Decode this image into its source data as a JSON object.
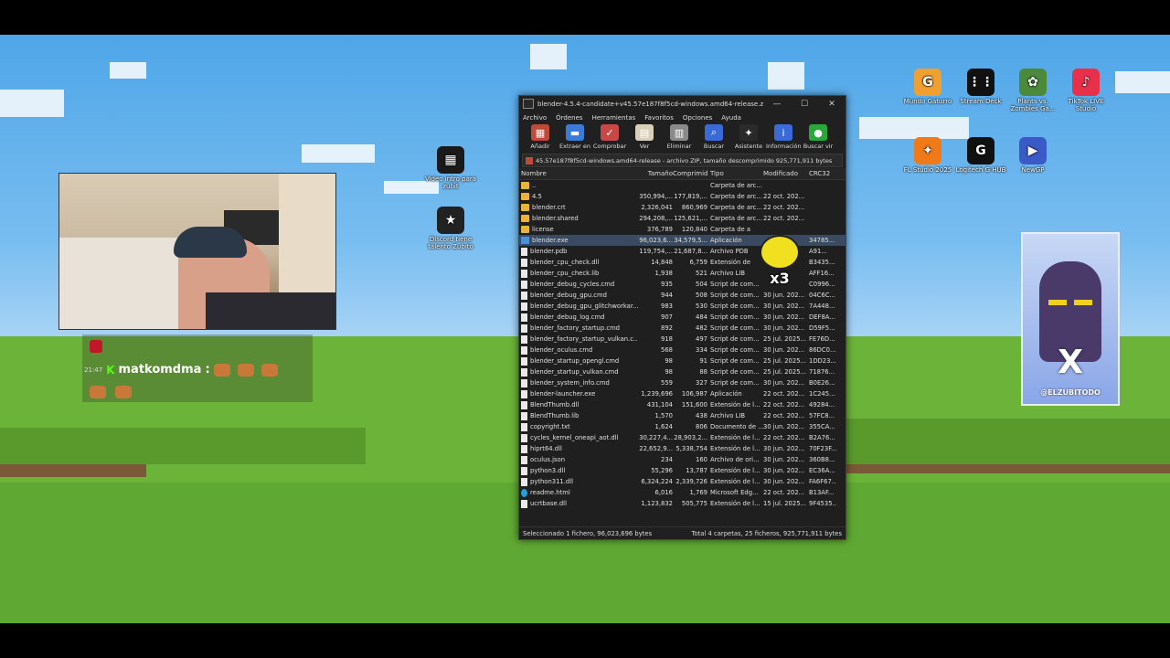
{
  "desktop": {
    "icons": [
      {
        "label": "Video intro para zubit",
        "symbol": "▦",
        "color": "#1a1a1a"
      },
      {
        "label": "Discord tiene talento Zubito",
        "symbol": "★",
        "color": "#222"
      },
      {
        "label": "Mundo Gaturro",
        "symbol": "G",
        "color": "#f0a030"
      },
      {
        "label": "Stream Deck",
        "symbol": "⋮⋮",
        "color": "#111"
      },
      {
        "label": "Plants vs. Zombies Ga...",
        "symbol": "✿",
        "color": "#4a8a3a"
      },
      {
        "label": "TikTok LIVE Studio",
        "symbol": "♪",
        "color": "#e8304a"
      },
      {
        "label": "FL Studio 2025",
        "symbol": "✦",
        "color": "#f07a18"
      },
      {
        "label": "Logitech G HUB",
        "symbol": "G",
        "color": "#111"
      },
      {
        "label": "NewGP",
        "symbol": "▶",
        "color": "#3a5ac8"
      }
    ]
  },
  "chat": {
    "time": "21:47",
    "user": "matkomdma",
    "separator": ":"
  },
  "window": {
    "title": "blender-4.5.4-candidate+v45.57e187f8f5cd-windows.amd64-release.zip (c...",
    "controls": {
      "minimize": "—",
      "maximize": "☐",
      "close": "✕"
    },
    "menu": [
      "Archivo",
      "Órdenes",
      "Herramientas",
      "Favoritos",
      "Opciones",
      "Ayuda"
    ],
    "toolbar": [
      {
        "label": "Añadir",
        "icon": "add-icon",
        "color": "#c04a3a",
        "glyph": "▦"
      },
      {
        "label": "Extraer en",
        "icon": "extract-icon",
        "color": "#3a7ad8",
        "glyph": "▬"
      },
      {
        "label": "Comprobar",
        "icon": "check-icon",
        "color": "#c84848",
        "glyph": "✓"
      },
      {
        "label": "Ver",
        "icon": "view-icon",
        "color": "#d8d0b8",
        "glyph": "▤"
      },
      {
        "label": "Eliminar",
        "icon": "delete-icon",
        "color": "#8a8a8a",
        "glyph": "▥"
      },
      {
        "label": "Buscar",
        "icon": "search-icon",
        "color": "#3a6ad8",
        "glyph": "⌕"
      },
      {
        "label": "Asistente",
        "icon": "wizard-icon",
        "color": "#2a2a2a",
        "glyph": "✦"
      },
      {
        "label": "Información",
        "icon": "info-icon",
        "color": "#3a6ad8",
        "glyph": "i"
      },
      {
        "label": "Buscar vir",
        "icon": "virus-scan-icon",
        "color": "#2aa83a",
        "glyph": "●"
      }
    ],
    "path": "45.57e187f8f5cd-windows.amd64-release - archivo ZIP, tamaño descomprimido 925,771,911 bytes",
    "columns": {
      "name": "Nombre",
      "size": "Tamaño",
      "compressed": "Comprimid",
      "type": "Tipo",
      "modified": "Modificado",
      "crc": "CRC32"
    },
    "rows": [
      {
        "name": "..",
        "kind": "folder",
        "size": "",
        "comp": "",
        "type": "Carpeta de arc...",
        "mod": "",
        "crc": ""
      },
      {
        "name": "4.5",
        "kind": "folder",
        "size": "350,994,...",
        "comp": "177,819,...",
        "type": "Carpeta de arc...",
        "mod": "22 oct. 202...",
        "crc": ""
      },
      {
        "name": "blender.crt",
        "kind": "folder",
        "size": "2,326,041",
        "comp": "860,969",
        "type": "Carpeta de arc...",
        "mod": "22 oct. 202...",
        "crc": ""
      },
      {
        "name": "blender.shared",
        "kind": "folder",
        "size": "294,208,...",
        "comp": "125,621,...",
        "type": "Carpeta de arc...",
        "mod": "22 oct. 202...",
        "crc": ""
      },
      {
        "name": "license",
        "kind": "folder",
        "size": "376,789",
        "comp": "120,840",
        "type": "Carpeta de a",
        "mod": "",
        "crc": ""
      },
      {
        "name": "blender.exe",
        "kind": "exe",
        "size": "96,023,6...",
        "comp": "34,579,5...",
        "type": "Aplicación",
        "mod": "",
        "crc": "34785...",
        "selected": true
      },
      {
        "name": "blender.pdb",
        "kind": "file",
        "size": "119,754,...",
        "comp": "21,687,8...",
        "type": "Archivo PDB",
        "mod": "",
        "crc": "A91..."
      },
      {
        "name": "blender_cpu_check.dll",
        "kind": "file",
        "size": "14,848",
        "comp": "6,759",
        "type": "Extensión de",
        "mod": "",
        "crc": "B3435..."
      },
      {
        "name": "blender_cpu_check.lib",
        "kind": "file",
        "size": "1,938",
        "comp": "521",
        "type": "Archivo LIB",
        "mod": "",
        "crc": "AFF16..."
      },
      {
        "name": "blender_debug_cycles.cmd",
        "kind": "file",
        "size": "935",
        "comp": "504",
        "type": "Script de com...",
        "mod": "",
        "crc": "C0996..."
      },
      {
        "name": "blender_debug_gpu.cmd",
        "kind": "file",
        "size": "944",
        "comp": "508",
        "type": "Script de com...",
        "mod": "30 jun. 202...",
        "crc": "04C6C..."
      },
      {
        "name": "blender_debug_gpu_glitchworkar...",
        "kind": "file",
        "size": "983",
        "comp": "530",
        "type": "Script de com...",
        "mod": "30 jun. 202...",
        "crc": "7A448..."
      },
      {
        "name": "blender_debug_log.cmd",
        "kind": "file",
        "size": "907",
        "comp": "484",
        "type": "Script de com...",
        "mod": "30 jun. 202...",
        "crc": "DEF8A..."
      },
      {
        "name": "blender_factory_startup.cmd",
        "kind": "file",
        "size": "892",
        "comp": "482",
        "type": "Script de com...",
        "mod": "30 jun. 202...",
        "crc": "D59F5..."
      },
      {
        "name": "blender_factory_startup_vulkan.c...",
        "kind": "file",
        "size": "918",
        "comp": "497",
        "type": "Script de com...",
        "mod": "25 jul. 2025...",
        "crc": "FE76D..."
      },
      {
        "name": "blender_oculus.cmd",
        "kind": "file",
        "size": "568",
        "comp": "334",
        "type": "Script de com...",
        "mod": "30 jun. 202...",
        "crc": "86DC0..."
      },
      {
        "name": "blender_startup_opengl.cmd",
        "kind": "file",
        "size": "98",
        "comp": "91",
        "type": "Script de com...",
        "mod": "25 jul. 2025...",
        "crc": "1DD23..."
      },
      {
        "name": "blender_startup_vulkan.cmd",
        "kind": "file",
        "size": "98",
        "comp": "88",
        "type": "Script de com...",
        "mod": "25 jul. 2025...",
        "crc": "71876..."
      },
      {
        "name": "blender_system_info.cmd",
        "kind": "file",
        "size": "559",
        "comp": "327",
        "type": "Script de com...",
        "mod": "30 jun. 202...",
        "crc": "B0E26..."
      },
      {
        "name": "blender-launcher.exe",
        "kind": "file",
        "size": "1,239,696",
        "comp": "106,987",
        "type": "Aplicación",
        "mod": "22 oct. 202...",
        "crc": "1C245..."
      },
      {
        "name": "BlendThumb.dll",
        "kind": "file",
        "size": "431,104",
        "comp": "151,600",
        "type": "Extensión de l...",
        "mod": "22 oct. 202...",
        "crc": "49284..."
      },
      {
        "name": "BlendThumb.lib",
        "kind": "file",
        "size": "1,570",
        "comp": "438",
        "type": "Archivo LIB",
        "mod": "22 oct. 202...",
        "crc": "57FC8..."
      },
      {
        "name": "copyright.txt",
        "kind": "file",
        "size": "1,624",
        "comp": "806",
        "type": "Documento de ...",
        "mod": "30 jun. 202...",
        "crc": "355CA..."
      },
      {
        "name": "cycles_kernel_oneapi_aot.dll",
        "kind": "file",
        "size": "30,227,4...",
        "comp": "28,903,2...",
        "type": "Extensión de l...",
        "mod": "22 oct. 202...",
        "crc": "B2A76..."
      },
      {
        "name": "hiprt64.dll",
        "kind": "file",
        "size": "22,652,9...",
        "comp": "5,338,754",
        "type": "Extensión de l...",
        "mod": "30 jun. 202...",
        "crc": "70F23F..."
      },
      {
        "name": "oculus.json",
        "kind": "file",
        "size": "234",
        "comp": "160",
        "type": "Archivo de ori...",
        "mod": "30 jun. 202...",
        "crc": "360B8..."
      },
      {
        "name": "python3.dll",
        "kind": "file",
        "size": "55,296",
        "comp": "13,787",
        "type": "Extensión de l...",
        "mod": "30 jun. 202...",
        "crc": "EC36A..."
      },
      {
        "name": "python311.dll",
        "kind": "file",
        "size": "6,324,224",
        "comp": "2,339,726",
        "type": "Extensión de l...",
        "mod": "30 jun. 202...",
        "crc": "FA6F67..."
      },
      {
        "name": "readme.html",
        "kind": "edge",
        "size": "6,016",
        "comp": "1,769",
        "type": "Microsoft Edg...",
        "mod": "22 oct. 202...",
        "crc": "B13AF..."
      },
      {
        "name": "ucrtbase.dll",
        "kind": "file",
        "size": "1,123,832",
        "comp": "505,775",
        "type": "Extensión de l...",
        "mod": "15 jul. 2025...",
        "crc": "9F4535..."
      }
    ],
    "status_left": "Seleccionado 1 fichero, 96,023,696 bytes",
    "status_right": "Total 4 carpetas, 25 ficheros, 925,771,911 bytes"
  },
  "overlay": {
    "badge": "x3",
    "sticker_handle": "@ELZUBITODO",
    "sticker_brand": "X"
  }
}
